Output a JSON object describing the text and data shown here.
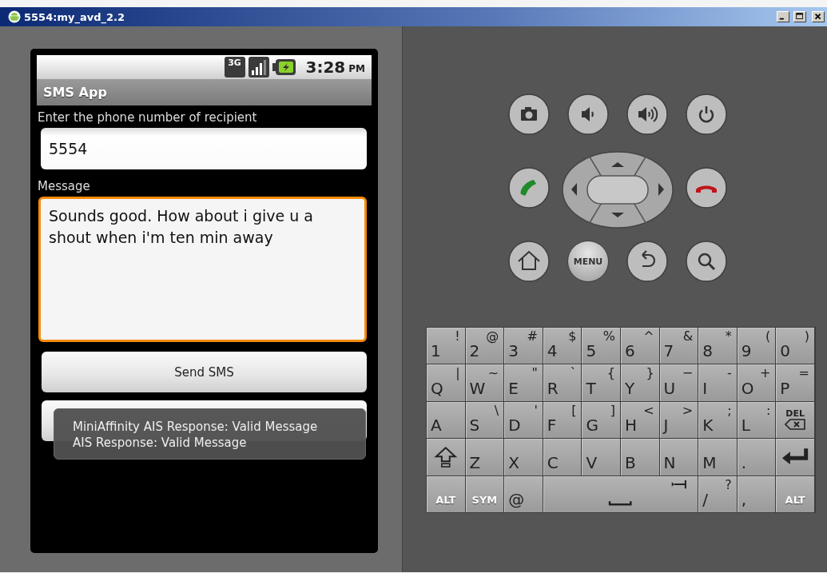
{
  "window": {
    "title": "5554:my_avd_2.2"
  },
  "status_bar": {
    "network": "3G",
    "time": "3:28",
    "ampm": "PM"
  },
  "app_bar": {
    "title": "SMS App"
  },
  "form": {
    "phone_label": "Enter the phone number of recipient",
    "phone_value": "5554",
    "message_label": "Message",
    "message_value": "Sounds good. How about i give u a shout when i'm ten min away",
    "message_focused": true
  },
  "buttons": [
    {
      "kind": "labeled",
      "label": "Send SMS"
    },
    {
      "kind": "blank"
    }
  ],
  "toast": {
    "lines": [
      "MiniAffinity AIS Response: Valid Message",
      "AIS Response: Valid Message"
    ]
  },
  "hardware_buttons": [
    {
      "kind": "camera"
    },
    {
      "kind": "volume-down"
    },
    {
      "kind": "volume-up"
    },
    {
      "kind": "power"
    },
    {
      "kind": "call"
    },
    {
      "kind": "dpad"
    },
    {
      "kind": "end-call"
    },
    {
      "kind": "home"
    },
    {
      "kind": "menu",
      "label": "MENU"
    },
    {
      "kind": "back"
    },
    {
      "kind": "search"
    }
  ],
  "keyboard": {
    "keys": [
      {
        "kind": "char",
        "label": "1",
        "alt": "!"
      },
      {
        "kind": "char",
        "label": "2",
        "alt": "@"
      },
      {
        "kind": "char",
        "label": "3",
        "alt": "#"
      },
      {
        "kind": "char",
        "label": "4",
        "alt": "$"
      },
      {
        "kind": "char",
        "label": "5",
        "alt": "%"
      },
      {
        "kind": "char",
        "label": "6",
        "alt": "^"
      },
      {
        "kind": "char",
        "label": "7",
        "alt": "&"
      },
      {
        "kind": "char",
        "label": "8",
        "alt": "*"
      },
      {
        "kind": "char",
        "label": "9",
        "alt": "("
      },
      {
        "kind": "char",
        "label": "0",
        "alt": ")"
      },
      {
        "kind": "char",
        "label": "Q",
        "alt": "|"
      },
      {
        "kind": "char",
        "label": "W",
        "alt": "~"
      },
      {
        "kind": "char",
        "label": "E",
        "alt": "\""
      },
      {
        "kind": "char",
        "label": "R",
        "alt": "`"
      },
      {
        "kind": "char",
        "label": "T",
        "alt": "{"
      },
      {
        "kind": "char",
        "label": "Y",
        "alt": "}"
      },
      {
        "kind": "char",
        "label": "U",
        "alt": "−"
      },
      {
        "kind": "char",
        "label": "I",
        "alt": "-"
      },
      {
        "kind": "char",
        "label": "O",
        "alt": "+"
      },
      {
        "kind": "char",
        "label": "P",
        "alt": "="
      },
      {
        "kind": "char",
        "label": "A"
      },
      {
        "kind": "char",
        "label": "S",
        "alt": "\\"
      },
      {
        "kind": "char",
        "label": "D",
        "alt": "'"
      },
      {
        "kind": "char",
        "label": "F",
        "alt": "["
      },
      {
        "kind": "char",
        "label": "G",
        "alt": "]"
      },
      {
        "kind": "char",
        "label": "H",
        "alt": "<"
      },
      {
        "kind": "char",
        "label": "J",
        "alt": ">"
      },
      {
        "kind": "char",
        "label": "K",
        "alt": ";"
      },
      {
        "kind": "char",
        "label": "L",
        "alt": ":"
      },
      {
        "kind": "del",
        "label": "DEL"
      },
      {
        "kind": "shift"
      },
      {
        "kind": "char",
        "label": "Z"
      },
      {
        "kind": "char",
        "label": "X"
      },
      {
        "kind": "char",
        "label": "C"
      },
      {
        "kind": "char",
        "label": "V"
      },
      {
        "kind": "char",
        "label": "B"
      },
      {
        "kind": "char",
        "label": "N"
      },
      {
        "kind": "char",
        "label": "M"
      },
      {
        "kind": "char",
        "label": "."
      },
      {
        "kind": "enter"
      },
      {
        "kind": "mod",
        "label": "ALT"
      },
      {
        "kind": "mod",
        "label": "SYM"
      },
      {
        "kind": "char",
        "label": "@"
      },
      {
        "kind": "space"
      },
      {
        "kind": "char",
        "label": "/",
        "alt": "?"
      },
      {
        "kind": "char",
        "label": ","
      },
      {
        "kind": "mod",
        "label": "ALT"
      }
    ]
  }
}
